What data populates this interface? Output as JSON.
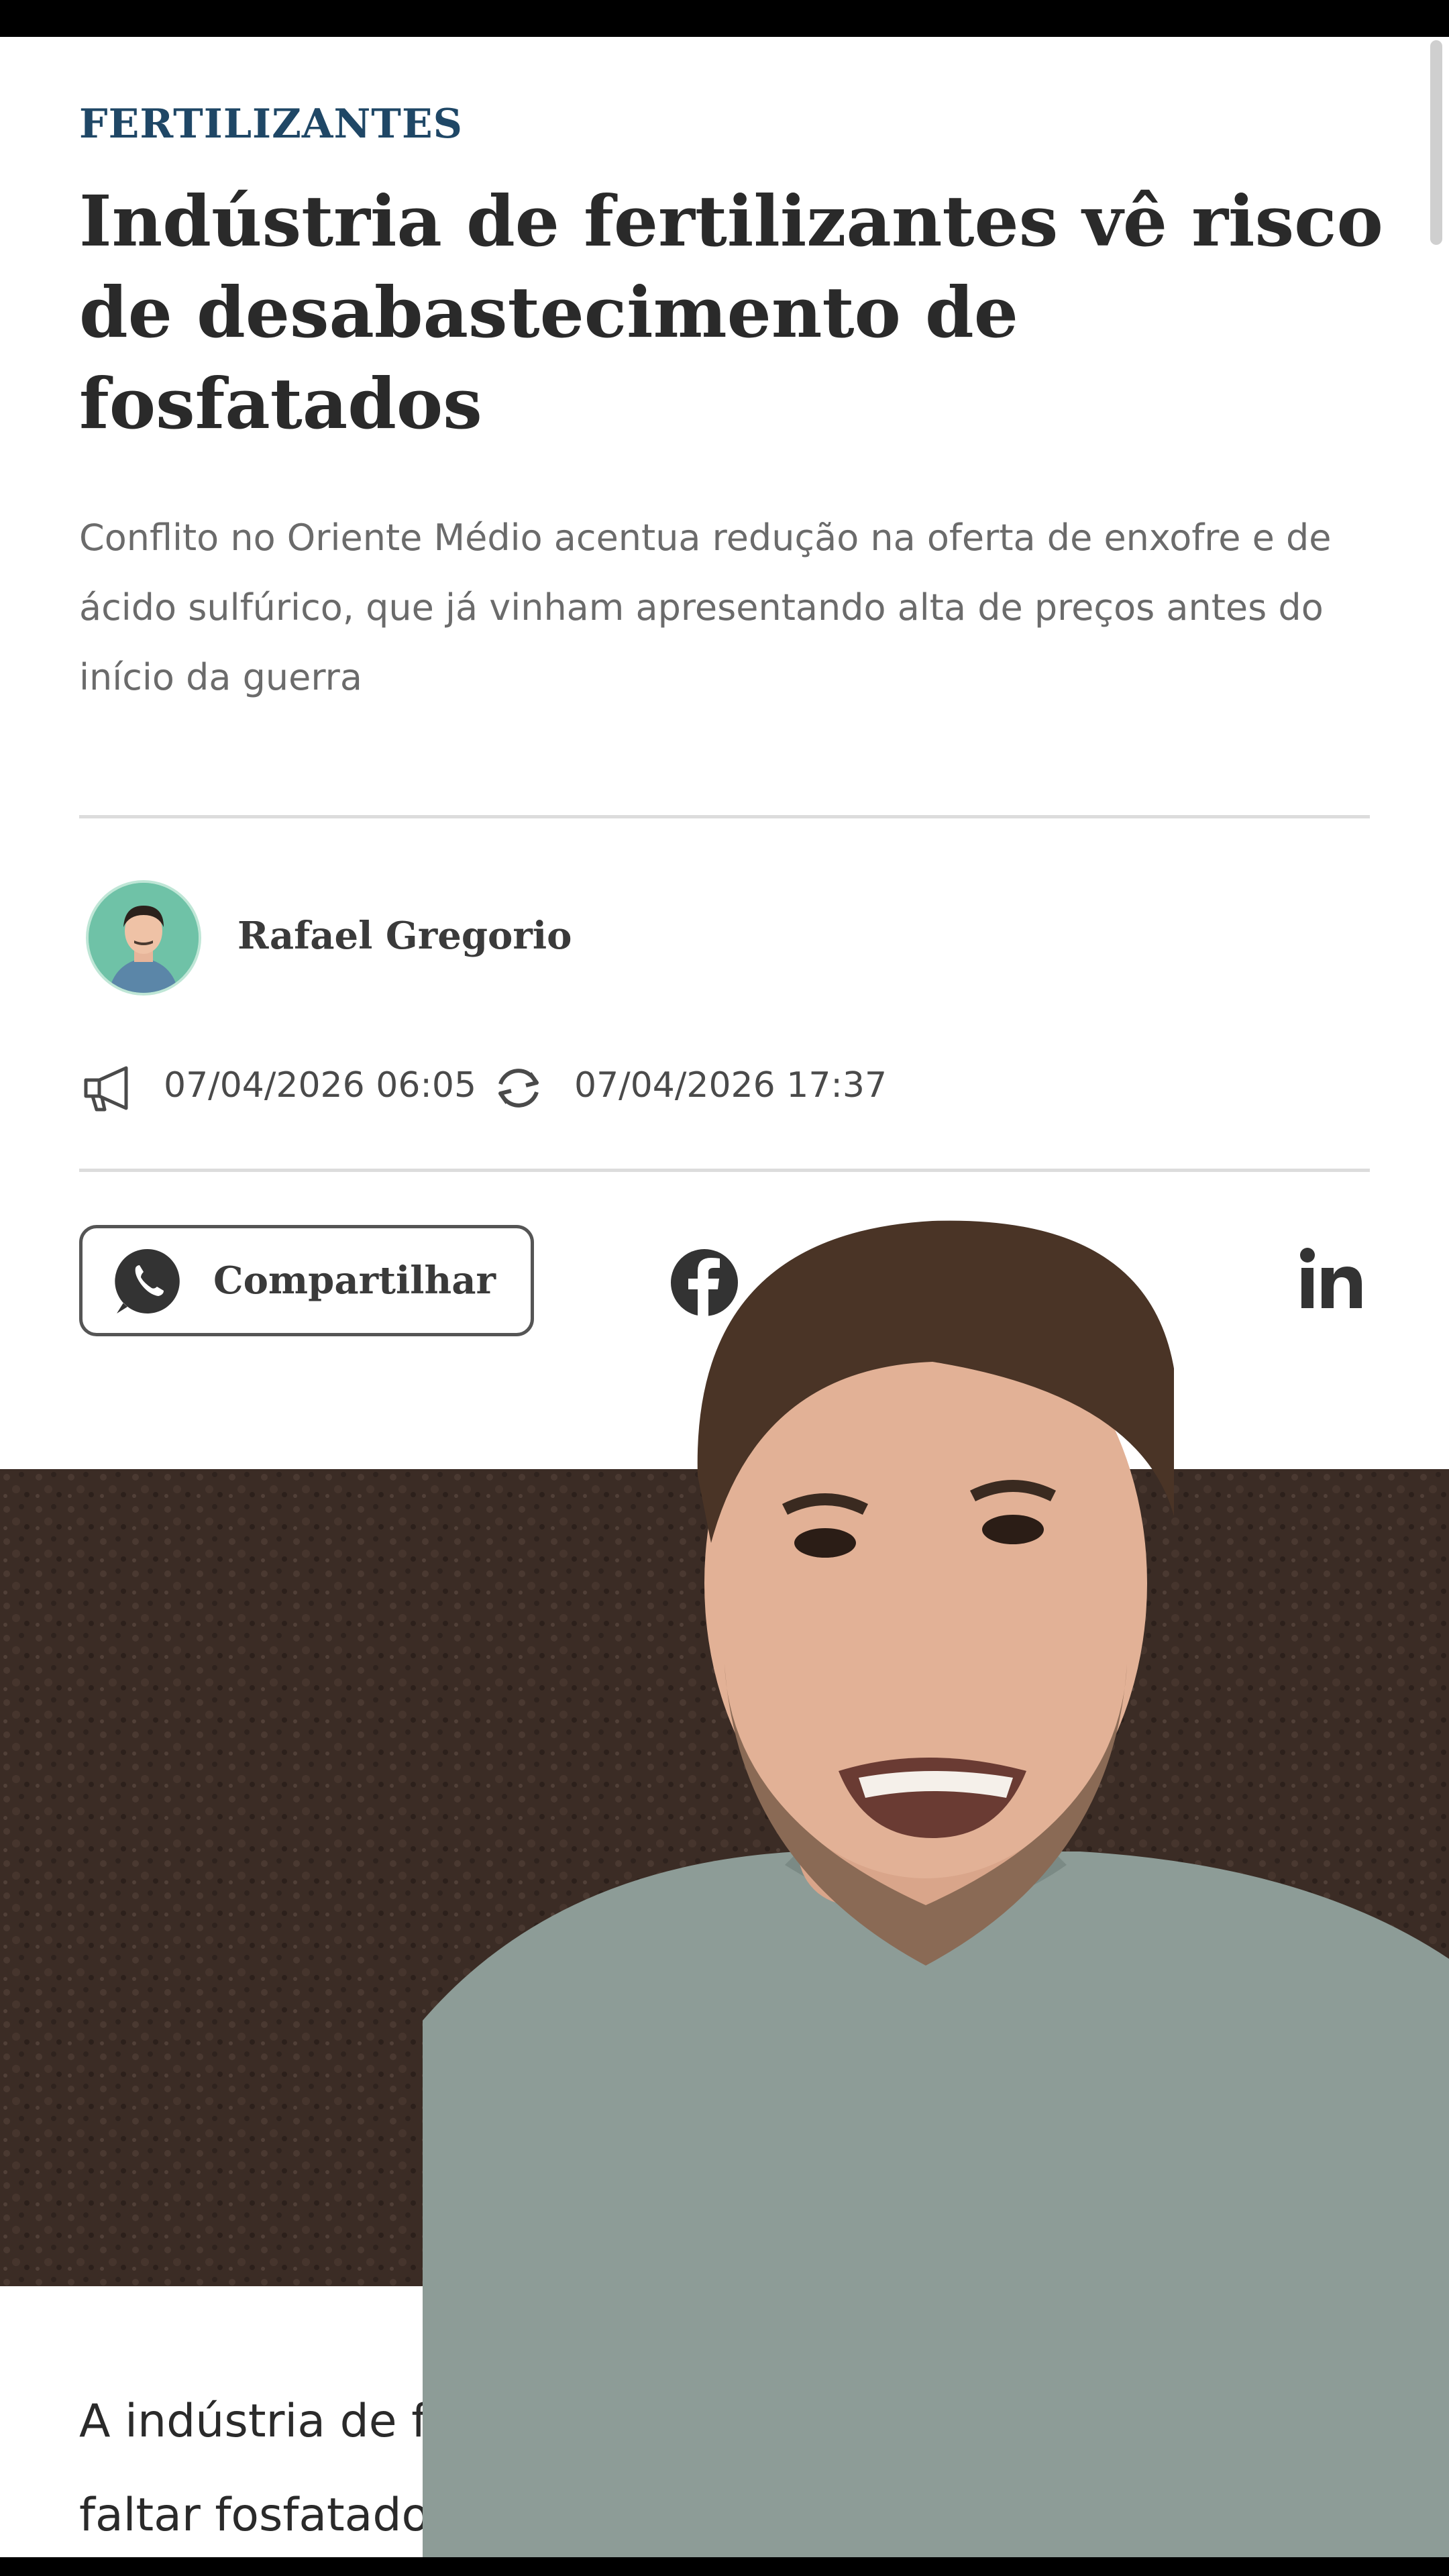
{
  "article": {
    "kicker": "FERTILIZANTES",
    "headline": "Indústria de fertilizantes vê risco de desabastecimento de fosfatados",
    "subtitle": "Conflito no Oriente Médio acentua redução na oferta de enxofre e de ácido sulfúrico, que já vinham apresentando alta de preços antes do início da guerra",
    "author": "Rafael Gregorio",
    "published": "07/04/2026 06:05",
    "updated": "07/04/2026 17:37",
    "lead_line1": "A indústria de f",
    "lead_line2": "faltar fosfatado"
  },
  "share": {
    "whatsapp_label": "Compartilhar",
    "icons": [
      "whatsapp-icon",
      "facebook-icon",
      "linkedin-icon"
    ]
  },
  "colors": {
    "kicker": "#1f4766",
    "text": "#2a2a2a",
    "muted": "#6b6b6b",
    "photo_background": "#3b2c25",
    "avatar_background": "#6fc2a7",
    "overlay_shirt": "#8d9c97"
  }
}
